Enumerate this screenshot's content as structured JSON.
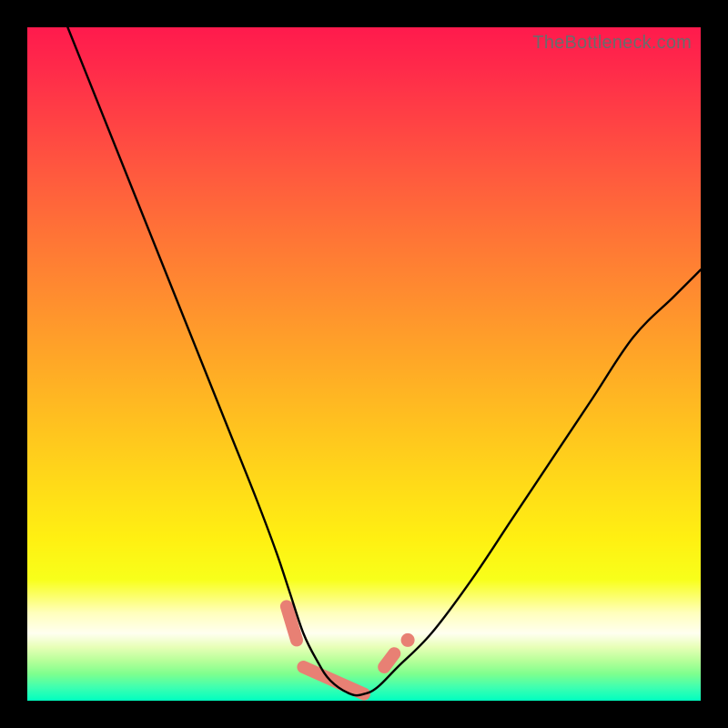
{
  "watermark": "TheBottleneck.com",
  "chart_data": {
    "type": "line",
    "title": "",
    "xlabel": "",
    "ylabel": "",
    "axes_visible": false,
    "xlim": [
      0,
      100
    ],
    "ylim": [
      0,
      100
    ],
    "background_gradient": {
      "direction": "top-to-bottom",
      "top_color": "#ff1a4d",
      "mid_color": "#ffd819",
      "bottom_color": "#00ffc0"
    },
    "series": [
      {
        "name": "bottleneck-curve",
        "stroke": "#000000",
        "x": [
          6,
          10,
          14,
          18,
          22,
          26,
          30,
          34,
          37,
          39,
          41,
          43,
          45,
          48,
          50,
          52,
          55,
          60,
          66,
          72,
          78,
          84,
          90,
          96,
          100
        ],
        "y": [
          100,
          90,
          80,
          70,
          60,
          50,
          40,
          30,
          22,
          16,
          10,
          6,
          3,
          1,
          1,
          2,
          5,
          10,
          18,
          27,
          36,
          45,
          54,
          60,
          64
        ]
      }
    ],
    "highlight": {
      "name": "optimal-range",
      "stroke": "#e88074",
      "segments": [
        {
          "x": [
            38.5,
            40.0
          ],
          "y": [
            14,
            9
          ]
        },
        {
          "x": [
            41.0,
            50.0
          ],
          "y": [
            5,
            1
          ]
        },
        {
          "x": [
            53.0,
            54.5
          ],
          "y": [
            5,
            7
          ]
        }
      ],
      "marker": {
        "x": 56.5,
        "y": 9
      }
    }
  }
}
